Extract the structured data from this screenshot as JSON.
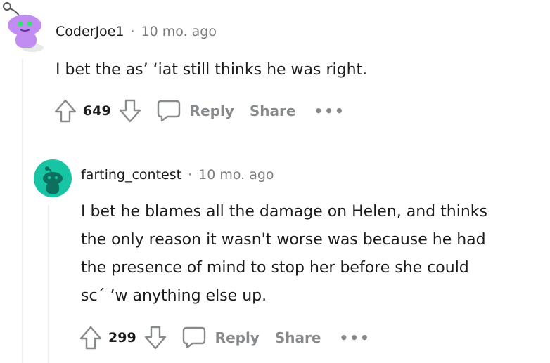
{
  "comments": [
    {
      "username": "CoderJoe1",
      "separator": "·",
      "time": "10 mo. ago",
      "body": "I bet the as’ ʻiat still thinks he was right.",
      "votes": "649",
      "reply_label": "Reply",
      "share_label": "Share",
      "more_label": "•••",
      "avatar_color": "#c28df2"
    },
    {
      "username": "farting_contest",
      "separator": "·",
      "time": "10 mo. ago",
      "body_lines": [
        "I bet he blames all the damage on Helen, and thinks",
        "the only reason it wasn't worse was because he had",
        "the presence of mind to stop her before she could",
        "sc´ ʼw anything else up."
      ],
      "votes": "299",
      "reply_label": "Reply",
      "share_label": "Share",
      "more_label": "•••",
      "avatar_color": "#17c5a5"
    }
  ],
  "colors": {
    "text": "#1c1c1c",
    "muted": "#878a8c",
    "thread_line": "#edeff1"
  }
}
